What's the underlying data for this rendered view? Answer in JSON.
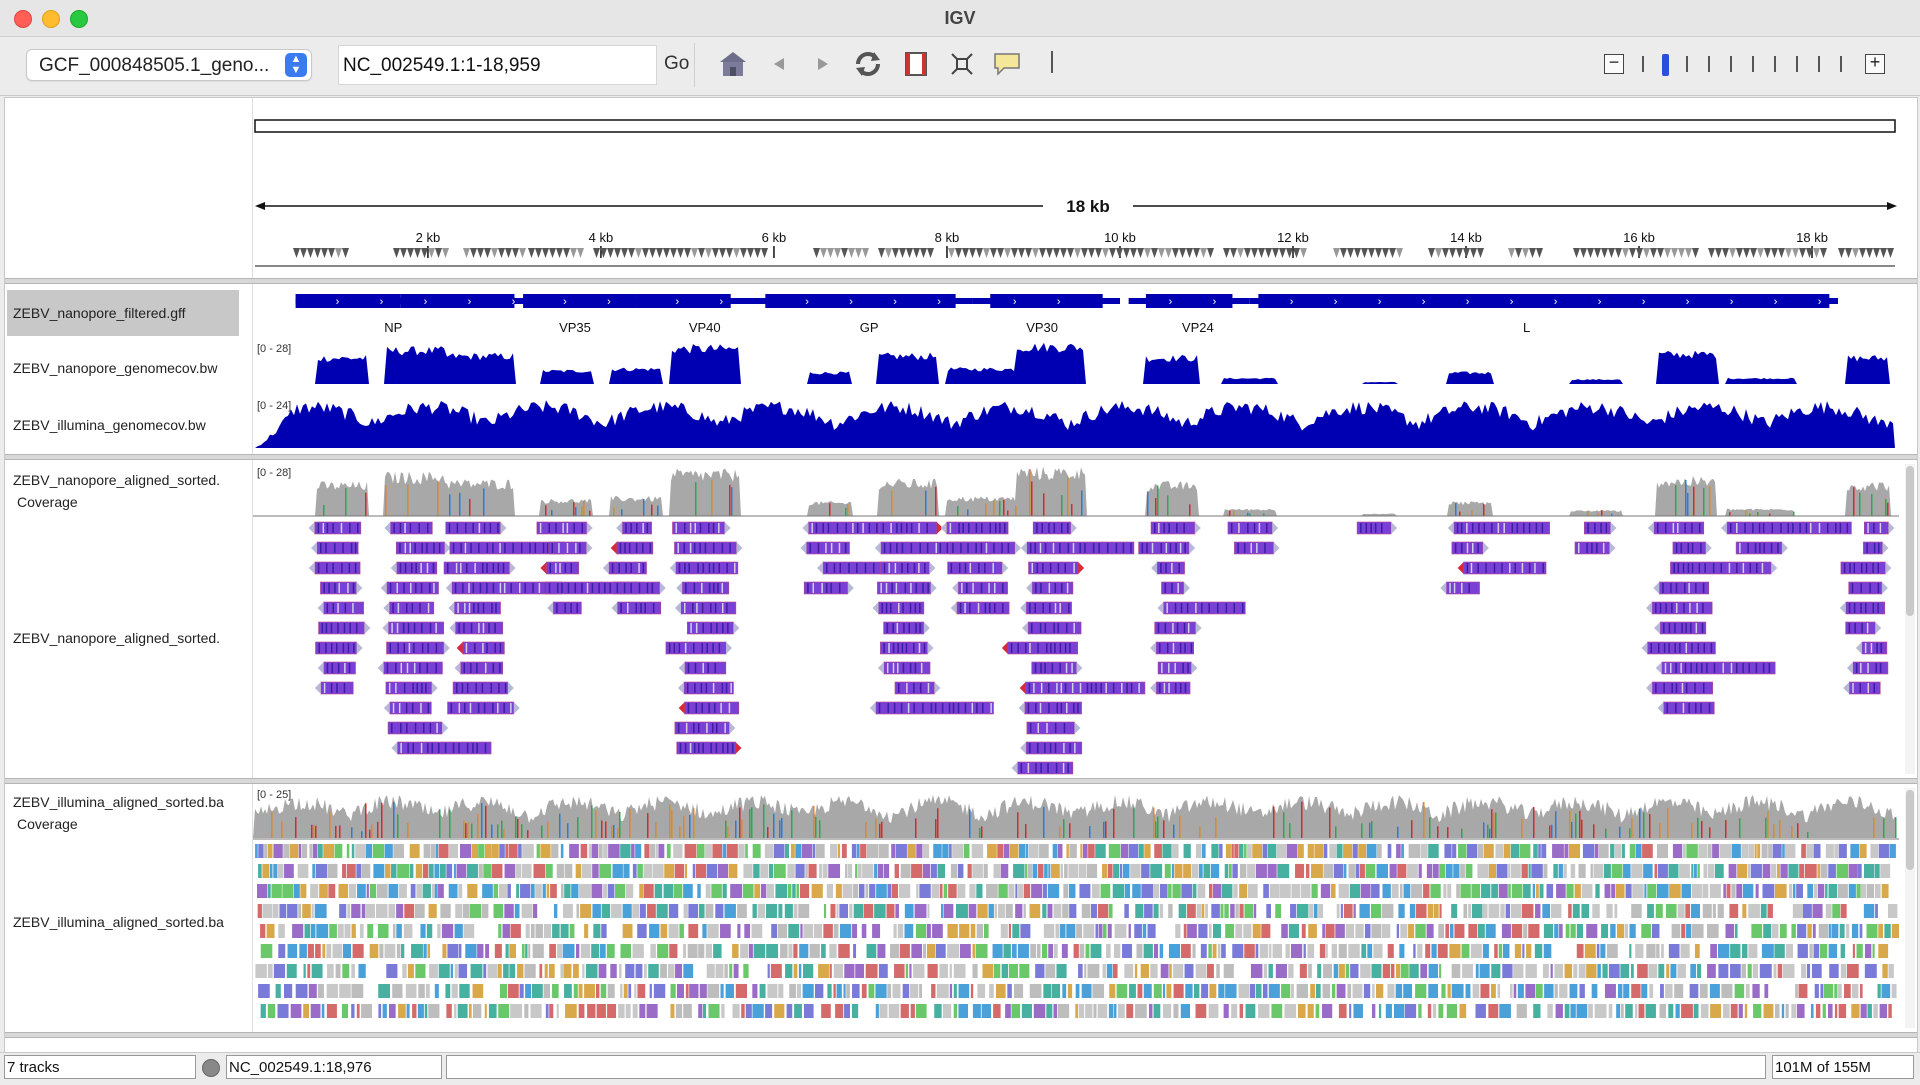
{
  "window": {
    "title": "IGV"
  },
  "toolbar": {
    "genome": "GCF_000848505.1_geno...",
    "locus": "NC_002549.1:1-18,959",
    "go_label": "Go",
    "icons": [
      "home-icon",
      "back-icon",
      "forward-icon",
      "refresh-icon",
      "region-of-interest-icon",
      "fit-to-window-icon",
      "popup-info-icon"
    ],
    "zoom": {
      "levels": 10,
      "selected_level": 1
    }
  },
  "ruler": {
    "span_label": "18 kb",
    "ticks": [
      "2 kb",
      "4 kb",
      "6 kb",
      "8 kb",
      "10 kb",
      "12 kb",
      "14 kb",
      "16 kb",
      "18 kb"
    ],
    "region_start": 1,
    "region_end": 18959
  },
  "tracks": {
    "gff": {
      "name": "ZEBV_nanopore_filtered.gff",
      "genes": [
        "NP",
        "VP35",
        "VP40",
        "GP",
        "VP30",
        "VP24",
        "L"
      ]
    },
    "nanopore_bw": {
      "name": "ZEBV_nanopore_genomecov.bw",
      "range": "[0 - 28]"
    },
    "illumina_bw": {
      "name": "ZEBV_illumina_genomecov.bw",
      "range": "[0 - 24]"
    },
    "nanopore_cov": {
      "name": "ZEBV_nanopore_aligned_sorted.",
      "sub": "Coverage",
      "range": "[0 - 28]"
    },
    "nanopore_aln": {
      "name": "ZEBV_nanopore_aligned_sorted."
    },
    "illumina_cov": {
      "name": "ZEBV_illumina_aligned_sorted.ba",
      "sub": "Coverage",
      "range": "[0 - 25]"
    },
    "illumina_aln": {
      "name": "ZEBV_illumina_aligned_sorted.ba"
    }
  },
  "colors": {
    "feature": "#0000b2",
    "read": "#7a3fd6",
    "coverage_gray": "#a8a8a8",
    "selection": "#c8c8c8"
  },
  "status": {
    "tracks": "7 tracks",
    "position": "NC_002549.1:18,976",
    "memory": "101M of 155M"
  }
}
